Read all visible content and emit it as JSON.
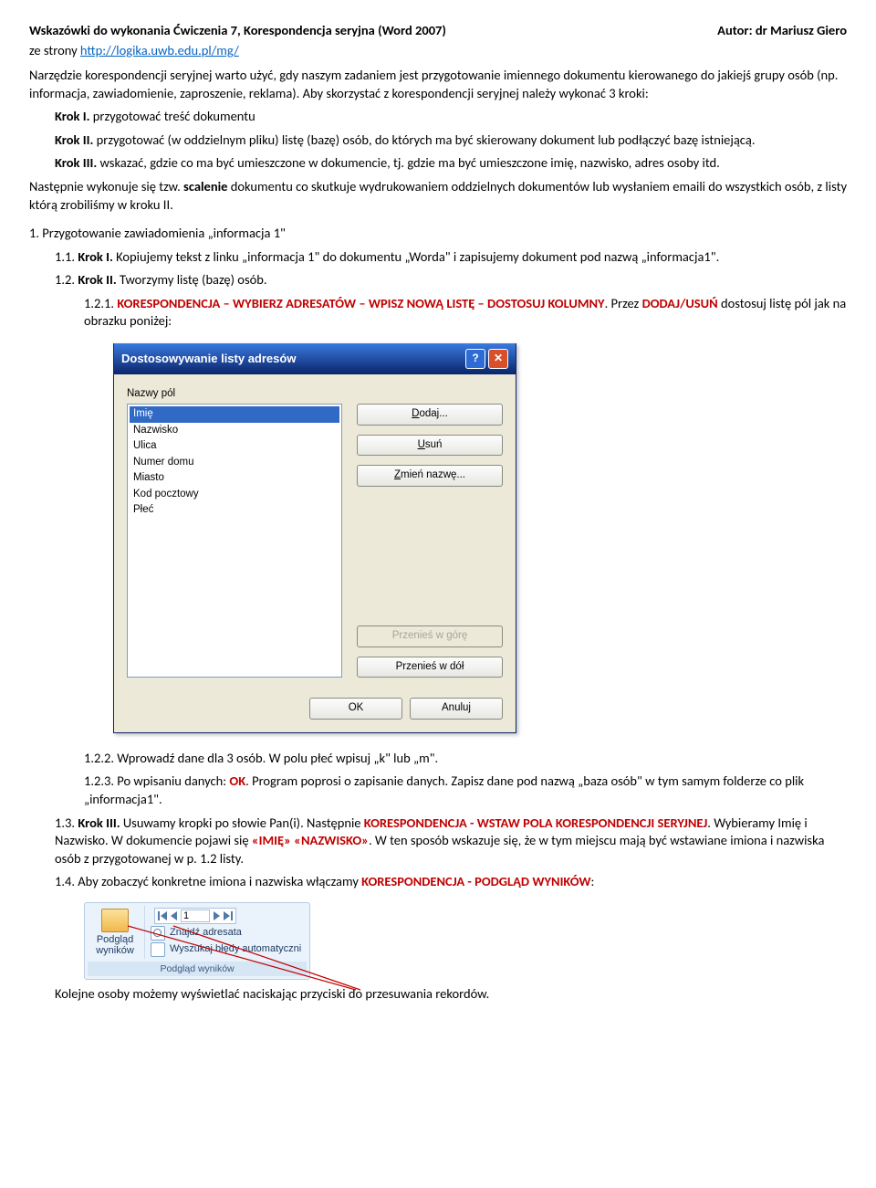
{
  "header": {
    "title": "Wskazówki do wykonania Ćwiczenia 7, Korespondencja seryjna (Word 2007)",
    "author": "Autor: dr Mariusz Giero",
    "sub_prefix": "ze strony ",
    "sub_link": "http://logika.uwb.edu.pl/mg/"
  },
  "para1": "Narzędzie korespondencji seryjnej warto użyć, gdy naszym zadaniem jest przygotowanie imiennego dokumentu kierowanego do jakiejś grupy osób (np. informacja, zawiadomienie, zaproszenie, reklama). Aby skorzystać z korespondencji seryjnej należy wykonać 3 kroki:",
  "krok1_lbl": "Krok I.",
  "krok1_txt": " przygotować treść dokumentu",
  "krok2_lbl": "Krok II.",
  "krok2_txt": " przygotować (w oddzielnym pliku) listę (bazę) osób, do których ma być skierowany dokument lub podłączyć bazę istniejącą.",
  "krok3_lbl": "Krok III.",
  "krok3_txt": " wskazać, gdzie co ma być umieszczone w dokumencie, tj. gdzie ma być umieszczone imię, nazwisko, adres osoby itd.",
  "para2_a": "Następnie wykonuje się tzw. ",
  "para2_b": "scalenie",
  "para2_c": " dokumentu co skutkuje wydrukowaniem oddzielnych dokumentów lub wysłaniem emaili do wszystkich osób, z listy którą zrobiliśmy w kroku II.",
  "s1": "1.    Przygotowanie zawiadomienia „informacja 1\"",
  "s11_a": "1.1.    ",
  "s11_b": "Krok I.",
  "s11_c": " Kopiujemy tekst z linku „informacja 1\" do dokumentu „Worda\" i zapisujemy dokument pod nazwą „informacja1\".",
  "s12_a": "1.2.    ",
  "s12_b": "Krok II.",
  "s12_c": " Tworzymy listę (bazę) osób.",
  "s121_a": "1.2.1.    ",
  "s121_b": "KORESPONDENCJA – WYBIERZ ADRESATÓW – WPISZ NOWĄ LISTĘ – DOSTOSUJ KOLUMNY",
  "s121_c": ". Przez ",
  "s121_d": "DODAJ/USUŃ",
  "s121_e": " dostosuj listę pól jak na obrazku poniżej:",
  "dialog": {
    "title": "Dostosowywanie listy adresów",
    "label": "Nazwy pól",
    "items": [
      "Imię",
      "Nazwisko",
      "Ulica",
      "Numer domu",
      "Miasto",
      "Kod pocztowy",
      "Płeć"
    ],
    "btn_add": "Dodaj...",
    "btn_del": "Usuń",
    "btn_ren": "Zmień nazwę...",
    "btn_up": "Przenieś w górę",
    "btn_down": "Przenieś w dół",
    "btn_ok": "OK",
    "btn_cancel": "Anuluj"
  },
  "s122": "1.2.2.    Wprowadź dane dla 3 osób. W polu płeć wpisuj „k\" lub „m\".",
  "s123_a": "1.2.3.    Po wpisaniu danych: ",
  "s123_b": "OK",
  "s123_c": ". Program poprosi o zapisanie danych. Zapisz dane pod nazwą „baza osób\" w tym samym folderze co plik „informacja1\".",
  "s13_a": "1.3.    ",
  "s13_b": "Krok III.",
  "s13_c": " Usuwamy kropki po słowie Pan(i). Następnie ",
  "s13_d": "KORESPONDENCJA - WSTAW POLA KORESPONDENCJI SERYJNEJ",
  "s13_e": ". Wybieramy Imię i Nazwisko. W dokumencie pojawi się ",
  "s13_f": "«IMIĘ» «NAZWISKO»",
  "s13_g": ". W ten sposób wskazuje się, że w tym miejscu mają być wstawiane imiona i nazwiska osób z przygotowanej w  p. 1.2 listy.",
  "s14_a": "1.4.    Aby zobaczyć konkretne imiona i nazwiska włączamy ",
  "s14_b": "KORESPONDENCJA - PODGLĄD WYNIKÓW",
  "s14_c": ":",
  "ribbon": {
    "big": "Podgląd wyników",
    "rec": "1",
    "line1": "Znajdź adresata",
    "line2": "Wyszukaj błędy automatyczni",
    "group": "Podgląd wyników"
  },
  "footer_line": "Kolejne osoby możemy wyświetlać naciskając przyciski do przesuwania rekordów."
}
